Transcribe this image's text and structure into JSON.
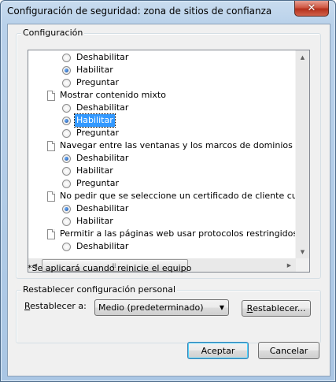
{
  "window": {
    "title": "Configuración de seguridad: zona de sitios de confianza",
    "close_glyph": "✕"
  },
  "settings_group": {
    "label": "Configuración",
    "note": "*Se aplicará cuando reinicie el equipo",
    "items": [
      {
        "kind": "option",
        "label": "Deshabilitar",
        "checked": false
      },
      {
        "kind": "option",
        "label": "Habilitar",
        "checked": true
      },
      {
        "kind": "option",
        "label": "Preguntar",
        "checked": false
      },
      {
        "kind": "heading",
        "label": "Mostrar contenido mixto"
      },
      {
        "kind": "option",
        "label": "Deshabilitar",
        "checked": false
      },
      {
        "kind": "option",
        "label": "Habilitar",
        "checked": true,
        "selected": true
      },
      {
        "kind": "option",
        "label": "Preguntar",
        "checked": false
      },
      {
        "kind": "heading",
        "label": "Navegar entre las ventanas y los marcos de dominios distinto"
      },
      {
        "kind": "option",
        "label": "Deshabilitar",
        "checked": true
      },
      {
        "kind": "option",
        "label": "Habilitar",
        "checked": false
      },
      {
        "kind": "option",
        "label": "Preguntar",
        "checked": false
      },
      {
        "kind": "heading",
        "label": "No pedir que se seleccione un certificado de cliente cuando e"
      },
      {
        "kind": "option",
        "label": "Deshabilitar",
        "checked": true
      },
      {
        "kind": "option",
        "label": "Habilitar",
        "checked": false
      },
      {
        "kind": "heading",
        "label": "Permitir a las páginas web usar protocolos restringidos para e"
      },
      {
        "kind": "option",
        "label": "Deshabilitar",
        "checked": false
      }
    ]
  },
  "reset_group": {
    "label": "Restablecer configuración personal",
    "reset_to_label_first": "R",
    "reset_to_label_rest": "establecer a:",
    "level_value": "Medio (predeterminado)",
    "reset_button_first": "R",
    "reset_button_rest": "establecer..."
  },
  "footer": {
    "ok_label": "Aceptar",
    "cancel_label": "Cancelar"
  },
  "scroll": {
    "horizontal_position": 0
  },
  "icons": {
    "up": "scroll-up-icon",
    "down": "scroll-down-icon",
    "left": "scroll-left-icon",
    "right": "scroll-right-icon"
  },
  "colors": {
    "selection": "#3399ff",
    "title_gradient_top": "#c9dcef",
    "close_button": "#c7402b"
  }
}
